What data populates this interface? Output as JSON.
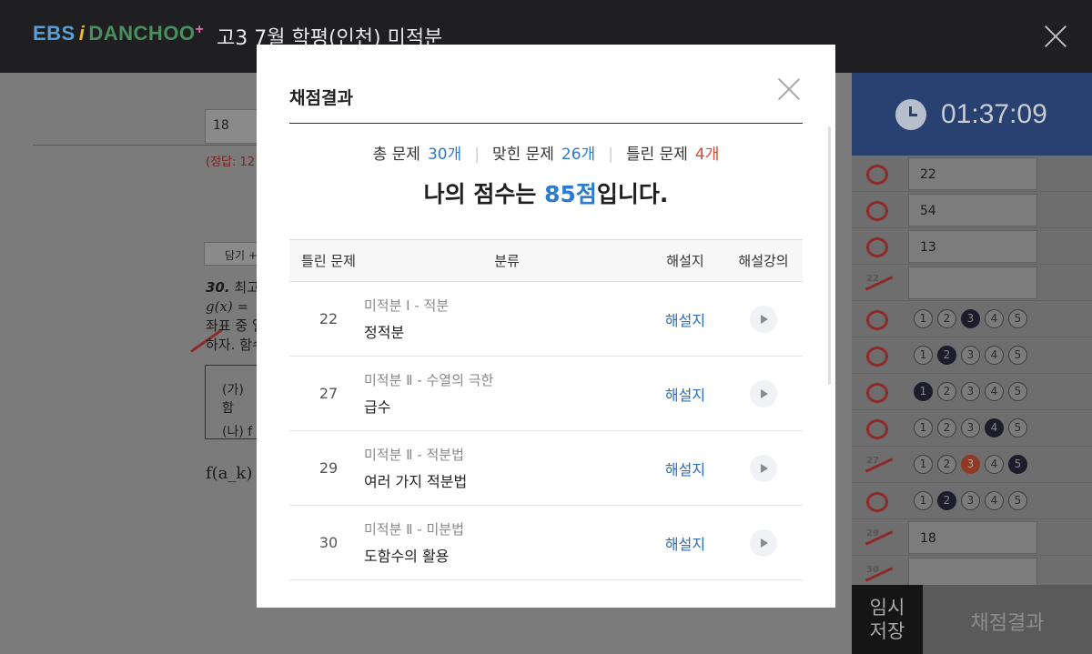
{
  "topbar": {
    "logo": {
      "ebs": "EBS",
      "i": "i",
      "danchoo": "DANCHOO",
      "plus": "+"
    },
    "title": "고3 7월 학평(인천) 미적분"
  },
  "background": {
    "answer_input": "18",
    "correct_answer": "(정답: 12",
    "btn_label": "담기 +",
    "question_number": "30.",
    "question_line1": "최고",
    "question_line2": "g(x) =",
    "question_line3": "좌표 중 일",
    "question_line4": "하자. 함수",
    "box_line1": "(가) 함",
    "box_line2": "(나) f",
    "formula": "f(a_k) :"
  },
  "timer": "01:37:09",
  "answers": [
    {
      "num": "19",
      "mark": "circle",
      "type": "input",
      "value": "22"
    },
    {
      "num": "20",
      "mark": "circle",
      "type": "input",
      "value": "54"
    },
    {
      "num": "21",
      "mark": "circle",
      "type": "input",
      "value": "13"
    },
    {
      "num": "22",
      "mark": "slash",
      "type": "input",
      "value": ""
    },
    {
      "num": "23",
      "mark": "circle",
      "type": "choice",
      "selected": 3
    },
    {
      "num": "24",
      "mark": "circle",
      "type": "choice",
      "selected": 2
    },
    {
      "num": "25",
      "mark": "circle",
      "type": "choice",
      "selected": 1
    },
    {
      "num": "26",
      "mark": "circle",
      "type": "choice",
      "selected": 4
    },
    {
      "num": "27",
      "mark": "slash",
      "type": "choice",
      "selected": 5,
      "correct": 3
    },
    {
      "num": "28",
      "mark": "circle",
      "type": "choice",
      "selected": 2
    },
    {
      "num": "29",
      "mark": "slash",
      "type": "input",
      "value": "18"
    },
    {
      "num": "30",
      "mark": "slash",
      "type": "input",
      "value": ""
    }
  ],
  "buttons": {
    "save_line1": "임시",
    "save_line2": "저장",
    "grade": "채점결과"
  },
  "modal": {
    "title": "채점결과",
    "total_label": "총 문제",
    "total_value": "30개",
    "correct_label": "맞힌 문제",
    "correct_value": "26개",
    "wrong_label": "틀린 문제",
    "wrong_value": "4개",
    "score_prefix": "나의 점수는 ",
    "score_value": "85점",
    "score_suffix": "입니다.",
    "headers": [
      "틀린 문제",
      "분류",
      "해설지",
      "해설강의"
    ],
    "rows": [
      {
        "num": "22",
        "category": "미적분 Ⅰ - 적분",
        "subject": "정적분",
        "link": "해설지"
      },
      {
        "num": "27",
        "category": "미적분 Ⅱ - 수열의 극한",
        "subject": "급수",
        "link": "해설지"
      },
      {
        "num": "29",
        "category": "미적분 Ⅱ - 적분법",
        "subject": "여러 가지 적분법",
        "link": "해설지"
      },
      {
        "num": "30",
        "category": "미적분 Ⅱ - 미분법",
        "subject": "도함수의 활용",
        "link": "해설지"
      }
    ]
  },
  "colors": {
    "accent_blue": "#2a7bd1",
    "wrong_red": "#d9483b",
    "timer_bg": "#284171"
  }
}
